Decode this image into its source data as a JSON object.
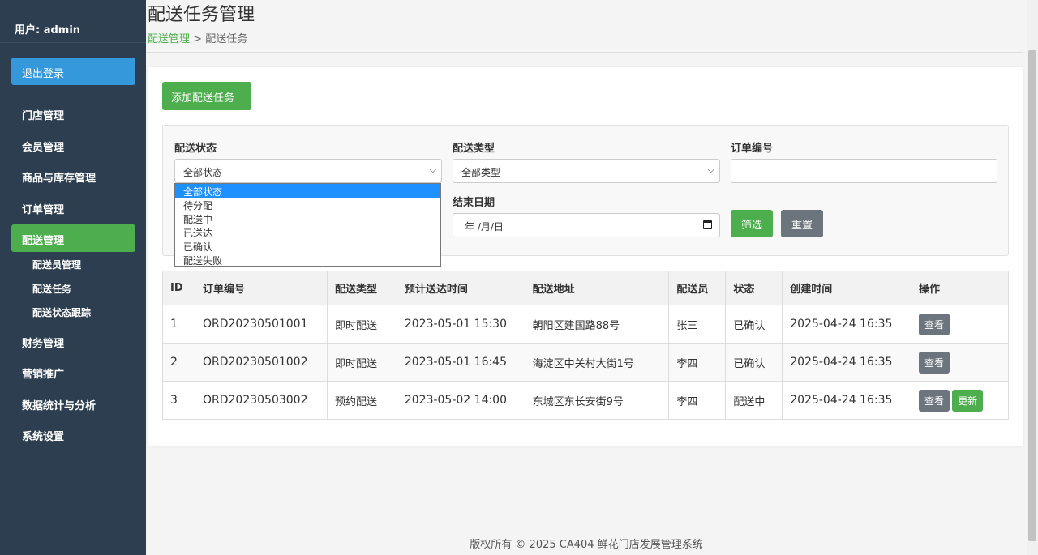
{
  "sidebar": {
    "user_label": "用户: admin",
    "logout": "退出登录",
    "items": [
      {
        "label": "门店管理"
      },
      {
        "label": "会员管理"
      },
      {
        "label": "商品与库存管理"
      },
      {
        "label": "订单管理"
      },
      {
        "label": "配送管理",
        "active": true
      },
      {
        "label": "财务管理"
      },
      {
        "label": "营销推广"
      },
      {
        "label": "数据统计与分析"
      },
      {
        "label": "系统设置"
      }
    ],
    "subitems": [
      {
        "label": "配送员管理"
      },
      {
        "label": "配送任务"
      },
      {
        "label": "配送状态跟踪"
      }
    ]
  },
  "header": {
    "title": "配送任务管理",
    "breadcrumb_parent": "配送管理",
    "breadcrumb_sep": " > ",
    "breadcrumb_current": "配送任务"
  },
  "toolbar": {
    "add_label": "添加配送任务"
  },
  "filters": {
    "status_label": "配送状态",
    "status_value": "全部状态",
    "status_options": [
      "全部状态",
      "待分配",
      "配送中",
      "已送达",
      "已确认",
      "配送失败"
    ],
    "type_label": "配送类型",
    "type_value": "全部类型",
    "order_label": "订单编号",
    "order_value": "",
    "end_date_label": "结束日期",
    "end_date_value": "年 /月/日",
    "filter_button": "筛选",
    "reset_button": "重置"
  },
  "table": {
    "headers": [
      "ID",
      "订单编号",
      "配送类型",
      "预计送达时间",
      "配送地址",
      "配送员",
      "状态",
      "创建时间",
      "操作"
    ],
    "rows": [
      {
        "id": "1",
        "order": "ORD20230501001",
        "type": "即时配送",
        "eta": "2023-05-01 15:30",
        "address": "朝阳区建国路88号",
        "courier": "张三",
        "status": "已确认",
        "created": "2025-04-24 16:35",
        "actions": [
          "查看"
        ]
      },
      {
        "id": "2",
        "order": "ORD20230501002",
        "type": "即时配送",
        "eta": "2023-05-01 16:45",
        "address": "海淀区中关村大街1号",
        "courier": "李四",
        "status": "已确认",
        "created": "2025-04-24 16:35",
        "actions": [
          "查看"
        ]
      },
      {
        "id": "3",
        "order": "ORD20230503002",
        "type": "预约配送",
        "eta": "2023-05-02 14:00",
        "address": "东城区东长安街9号",
        "courier": "李四",
        "status": "配送中",
        "created": "2025-04-24 16:35",
        "actions": [
          "查看",
          "更新"
        ]
      }
    ]
  },
  "footer": {
    "text": "版权所有 © 2025 CA404 鲜花门店发展管理系统"
  },
  "colors": {
    "sidebar_bg": "#2c3e50",
    "primary": "#3498db",
    "success": "#4cae4c",
    "secondary": "#6c757d"
  }
}
